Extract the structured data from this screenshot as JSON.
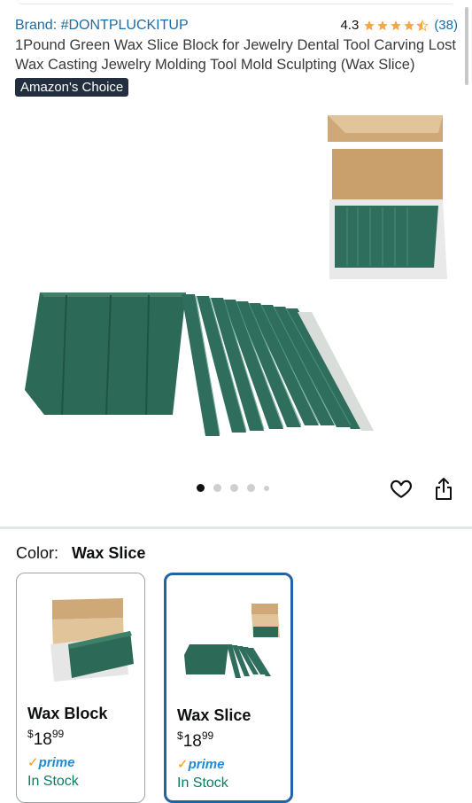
{
  "header": {
    "brand": "Brand: #DONTPLUCKITUP",
    "rating_value": "4.3",
    "rating_count": "(38)",
    "stars": 4.3,
    "title": "1Pound Green Wax Slice Block for Jewelry Dental Tool Carving Lost Wax Casting Jewelry Molding Tool Mold Sculpting (Wax Slice)",
    "badge": "Amazon's Choice"
  },
  "gallery": {
    "image_count": 5,
    "active_index": 0
  },
  "variation": {
    "label": "Color:",
    "selected": "Wax Slice",
    "options": [
      {
        "name": "Wax Block",
        "price_symbol": "$",
        "price_whole": "18",
        "price_cents": "99",
        "prime": "prime",
        "stock": "In Stock"
      },
      {
        "name": "Wax Slice",
        "price_symbol": "$",
        "price_whole": "18",
        "price_cents": "99",
        "prime": "prime",
        "stock": "In Stock"
      }
    ]
  },
  "colors": {
    "link": "#1a6ea8",
    "star": "#f3a847",
    "badge_bg": "#232f3e",
    "selected_border": "#2162a1",
    "in_stock": "#067d62",
    "wax_green": "#2f6e5c"
  }
}
